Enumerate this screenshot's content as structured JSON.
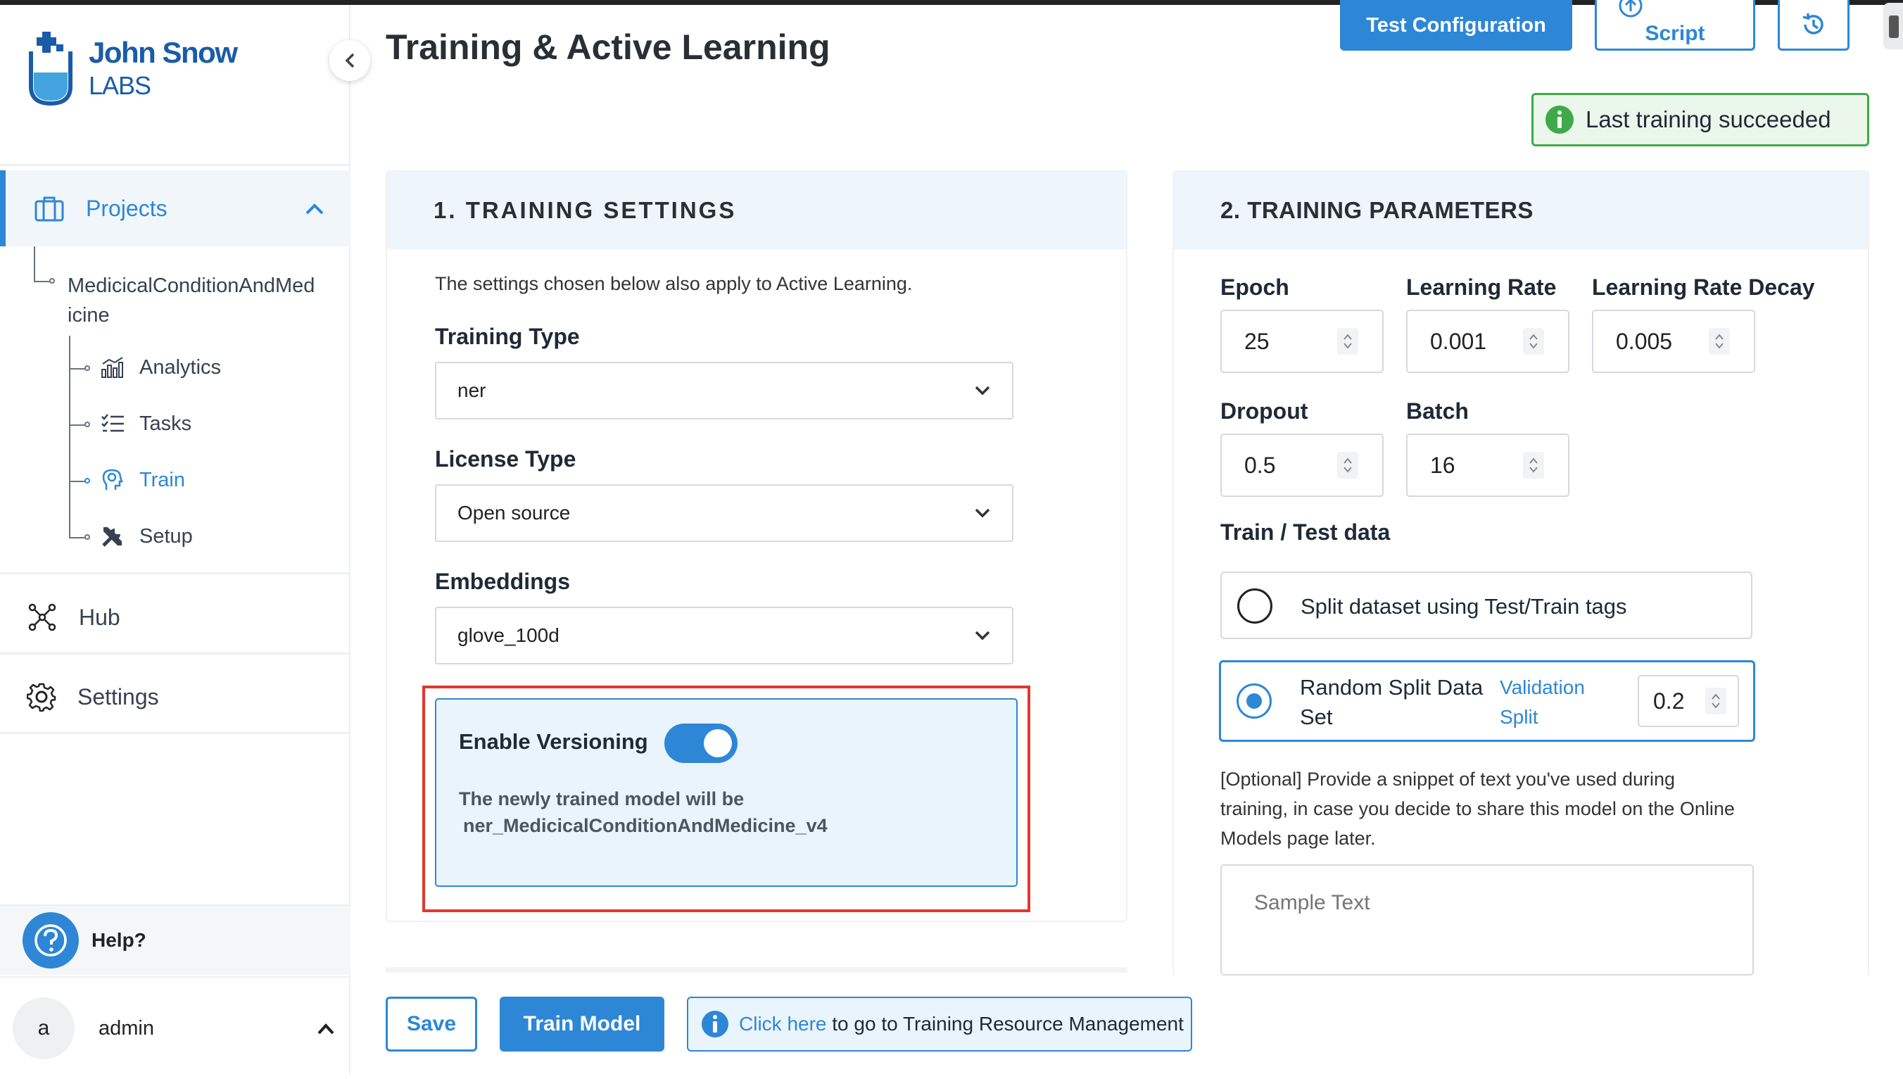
{
  "brand": {
    "name_line1": "John Snow",
    "name_line2": "LABS"
  },
  "sidebar": {
    "projects_label": "Projects",
    "project_name": "MedicicalConditionAndMed\nicine",
    "sub_items": [
      {
        "label": "Analytics"
      },
      {
        "label": "Tasks"
      },
      {
        "label": "Train"
      },
      {
        "label": "Setup"
      }
    ],
    "hub_label": "Hub",
    "settings_label": "Settings",
    "help_label": "Help?",
    "user_initial": "a",
    "user_name": "admin"
  },
  "page": {
    "title": "Training & Active Learning"
  },
  "header_actions": {
    "test_config_label": "Test Configuration",
    "custom_script_label": "Script"
  },
  "status": {
    "text": "Last training succeeded"
  },
  "training_settings": {
    "heading": "1. TRAINING SETTINGS",
    "note": "The settings chosen below also apply to Active Learning.",
    "training_type_label": "Training Type",
    "training_type_value": "ner",
    "license_type_label": "License Type",
    "license_type_value": "Open source",
    "embeddings_label": "Embeddings",
    "embeddings_value": "glove_100d",
    "versioning_label": "Enable Versioning",
    "versioning_enabled": true,
    "versioning_note_line1": "The newly trained model will be",
    "versioning_note_line2": "ner_MedicicalConditionAndMedicine_v4"
  },
  "training_params": {
    "heading": "2. TRAINING PARAMETERS",
    "epoch_label": "Epoch",
    "epoch_value": "25",
    "lr_label": "Learning Rate",
    "lr_value": "0.001",
    "lrd_label": "Learning Rate Decay",
    "lrd_value": "0.005",
    "dropout_label": "Dropout",
    "dropout_value": "0.5",
    "batch_label": "Batch",
    "batch_value": "16",
    "split_label": "Train / Test data",
    "split_option1": "Split dataset using Test/Train tags",
    "split_option2_line1": "Random Split Data",
    "split_option2_line2": "Set",
    "validation_line1": "Validation",
    "validation_line2": "Split",
    "validation_value": "0.2",
    "optional_line1": "[Optional] Provide a snippet of text you've used during",
    "optional_line2": "training, in case you decide to share this model on the Online",
    "optional_line3": "Models page later.",
    "sample_placeholder": "Sample Text"
  },
  "footer": {
    "save_label": "Save",
    "train_label": "Train Model",
    "info_link": "Click here",
    "info_text": " to go to Training Resource Management"
  },
  "colors": {
    "accent": "#2d87d6",
    "success": "#3fa94a",
    "highlight": "#e0392b"
  }
}
